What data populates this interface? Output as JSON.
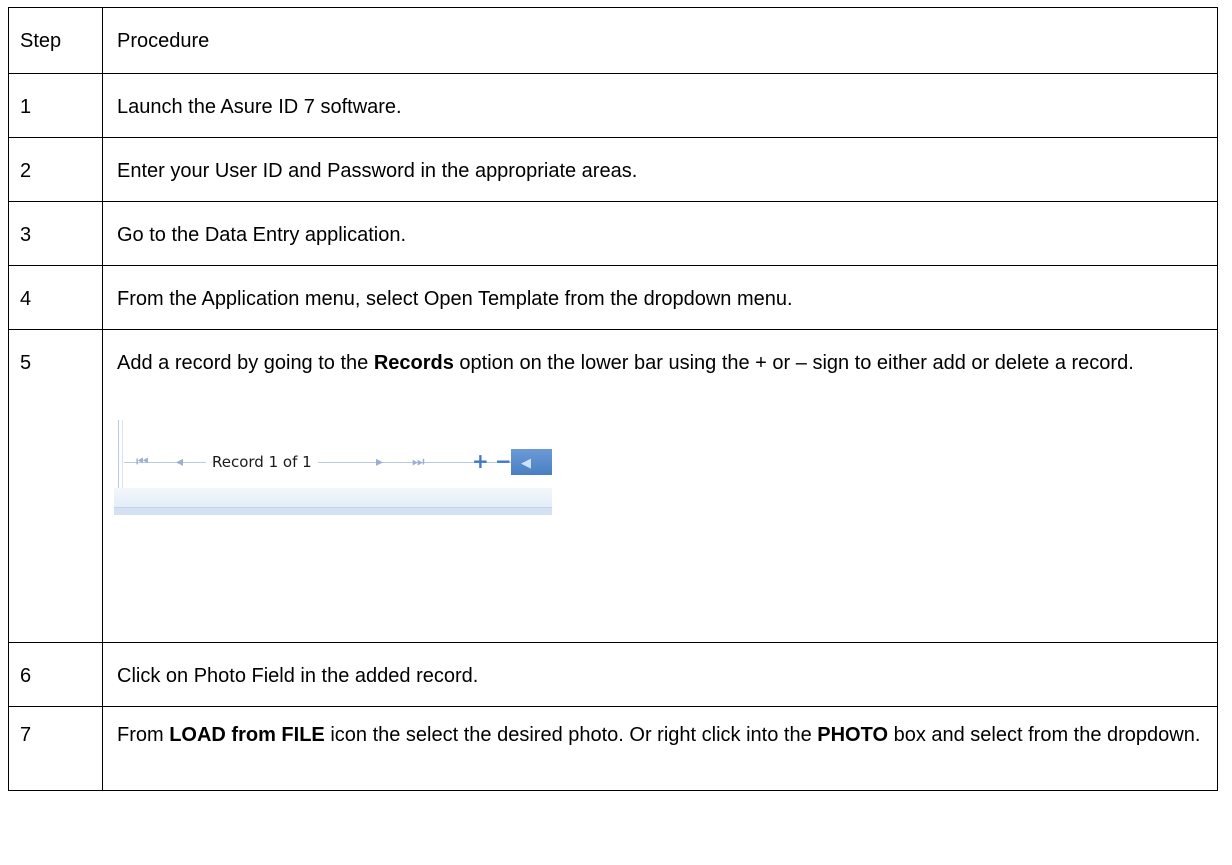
{
  "table": {
    "header": {
      "step": "Step",
      "procedure": "Procedure"
    },
    "rows": [
      {
        "step": "1",
        "text": "Launch the Asure ID 7 software."
      },
      {
        "step": "2",
        "text": "Enter your User ID and Password in the appropriate areas."
      },
      {
        "step": "3",
        "text": "Go to the Data Entry application."
      },
      {
        "step": "4",
        "text": "From the Application menu, select Open Template from the dropdown menu."
      },
      {
        "step": "5",
        "text_a": "Add a record by going to the ",
        "bold_a": "Records",
        "text_b": " option on the lower bar using the + or – sign to either add or delete a record."
      },
      {
        "step": "6",
        "text": "Click on Photo Field in the added record."
      },
      {
        "step": "7",
        "text_a": "From ",
        "bold_a": "LOAD from FILE",
        "text_b": " icon the select the desired photo. Or right click into the ",
        "bold_b": "PHOTO",
        "text_c": " box and select from the dropdown."
      }
    ]
  },
  "record_navigator": {
    "label": "Record 1 of 1",
    "first_icon": "first-record-icon",
    "prev_icon": "previous-record-icon",
    "next_icon": "next-record-icon",
    "last_icon": "last-record-icon",
    "add_icon": "add-record-icon",
    "delete_icon": "delete-record-icon",
    "accent": "#3f78c9"
  }
}
